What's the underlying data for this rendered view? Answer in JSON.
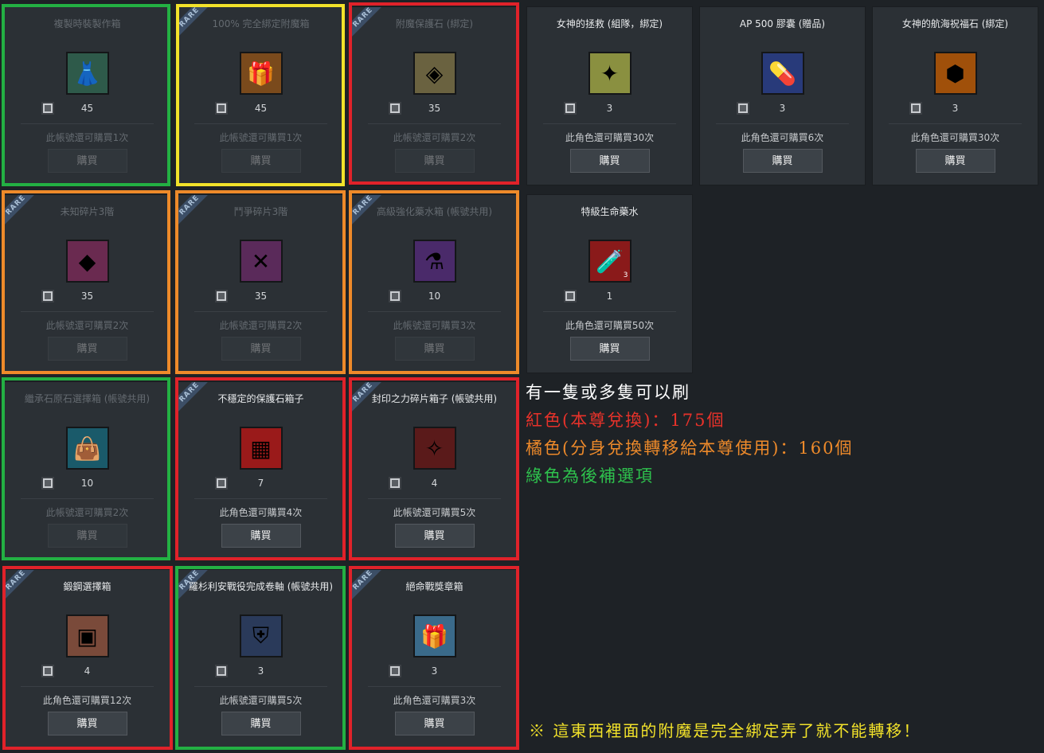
{
  "buy_label": "購買",
  "highlight_colors": {
    "red": "#e0222a",
    "orange": "#ee8a2a",
    "green": "#23b043",
    "yellow": "#f2e22a"
  },
  "items": [
    {
      "title": "複製時裝製作箱",
      "price": "45",
      "limit": "此帳號還可購買1次",
      "rare": false,
      "faded": true,
      "icon": "mannequin-icon",
      "glyph": "👗",
      "icon_bg": "#2e5a4a"
    },
    {
      "title": "100% 完全綁定附魔箱",
      "price": "45",
      "limit": "此帳號還可購買1次",
      "rare": true,
      "faded": true,
      "icon": "gift-box-icon",
      "glyph": "🎁",
      "icon_bg": "#7a4a1c"
    },
    {
      "title": "附魔保護石 (綁定)",
      "price": "35",
      "limit": "此帳號還可購買2次",
      "rare": true,
      "faded": true,
      "icon": "protection-stone-icon",
      "glyph": "◈",
      "icon_bg": "#6a6240"
    },
    {
      "title": "女神的拯救 (組隊，綁定)",
      "price": "3",
      "limit": "此角色還可購買30次",
      "rare": false,
      "faded": false,
      "icon": "goddess-icon",
      "glyph": "✦",
      "icon_bg": "#8a9040"
    },
    {
      "title": "AP 500 膠囊 (贈品)",
      "price": "3",
      "limit": "此角色還可購買6次",
      "rare": false,
      "faded": false,
      "icon": "capsule-icon",
      "glyph": "💊",
      "icon_bg": "#283a7a"
    },
    {
      "title": "女神的航海祝福石 (綁定)",
      "price": "3",
      "limit": "此角色還可購買30次",
      "rare": false,
      "faded": false,
      "icon": "amber-stone-icon",
      "glyph": "⬢",
      "icon_bg": "#a0500a"
    },
    {
      "title": "未知碎片3階",
      "price": "35",
      "limit": "此帳號還可購買2次",
      "rare": true,
      "faded": true,
      "icon": "crystal-shard-icon",
      "glyph": "◆",
      "icon_bg": "#6a2a50"
    },
    {
      "title": "鬥爭碎片3階",
      "price": "35",
      "limit": "此帳號還可購買2次",
      "rare": true,
      "faded": true,
      "icon": "battle-shard-icon",
      "glyph": "✕",
      "icon_bg": "#5a2a5a"
    },
    {
      "title": "高級強化藥水箱 (帳號共用)",
      "price": "10",
      "limit": "此帳號還可購買3次",
      "rare": true,
      "faded": true,
      "icon": "potion-box-icon",
      "glyph": "⚗",
      "icon_bg": "#4a2a6a"
    },
    {
      "title": "特級生命藥水",
      "price": "1",
      "limit": "此角色還可購買50次",
      "rare": false,
      "faded": false,
      "icon": "red-potion-icon",
      "glyph": "🧪",
      "icon_bg": "#8a1a1a",
      "badge": "3"
    },
    {
      "title": "繼承石原石選擇箱 (帳號共用)",
      "price": "10",
      "limit": "此帳號還可購買2次",
      "rare": false,
      "faded": true,
      "icon": "stone-bag-icon",
      "glyph": "👜",
      "icon_bg": "#1a5a6a"
    },
    {
      "title": "不穩定的保護石箱子",
      "price": "7",
      "limit": "此角色還可購買4次",
      "rare": true,
      "faded": false,
      "icon": "red-box-icon",
      "glyph": "▦",
      "icon_bg": "#9a1a1a"
    },
    {
      "title": "封印之力碎片箱子 (帳號共用)",
      "price": "4",
      "limit": "此帳號還可購買5次",
      "rare": true,
      "faded": false,
      "icon": "seal-shard-box-icon",
      "glyph": "✧",
      "icon_bg": "#5a1a1a"
    },
    {
      "title": "鍛鋼選擇箱",
      "price": "4",
      "limit": "此角色還可購買12次",
      "rare": true,
      "faded": false,
      "icon": "steel-box-icon",
      "glyph": "▣",
      "icon_bg": "#7a4a3a"
    },
    {
      "title": "羅杉利安戰役完成卷軸 (帳號共用)",
      "price": "3",
      "limit": "此帳號還可購買5次",
      "rare": true,
      "faded": false,
      "icon": "emblem-scroll-icon",
      "glyph": "⛨",
      "icon_bg": "#2a3a5a"
    },
    {
      "title": "絕命戰獎章箱",
      "price": "3",
      "limit": "此角色還可購買3次",
      "rare": true,
      "faded": false,
      "icon": "medal-box-icon",
      "glyph": "🎁",
      "icon_bg": "#3a6a8a"
    }
  ],
  "notes": {
    "line1": "有一隻或多隻可以刷",
    "line2": "紅色(本尊兌換)：175個",
    "line3": "橘色(分身兌換轉移給本尊使用)：160個",
    "line4": "綠色為後補選項",
    "footer": "※  這東西裡面的附魔是完全綁定弄了就不能轉移！"
  }
}
